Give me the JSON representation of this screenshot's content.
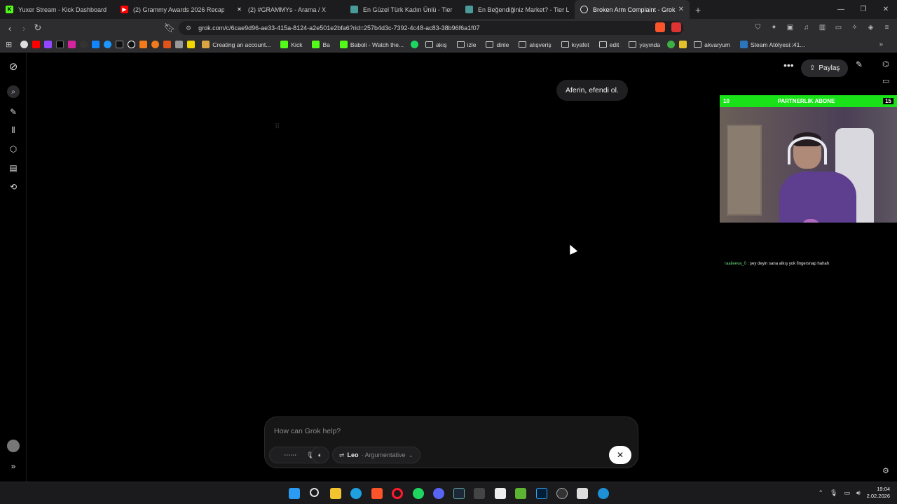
{
  "tabs": [
    {
      "label": "Yuxer Stream - Kick Dashboard",
      "icon": "kick-icon",
      "color": "#53fc18"
    },
    {
      "label": "(2) Grammy Awards 2026 Recap: Win",
      "icon": "youtube-icon",
      "color": "#ff0000"
    },
    {
      "label": "(2) #GRAMMYs - Arama / X",
      "icon": "x-icon",
      "color": "#ffffff"
    },
    {
      "label": "En Güzel Türk Kadın Ünlü - Tier List |",
      "icon": "tiermaker-icon",
      "color": "#4a9a9a"
    },
    {
      "label": "En Beğendiğiniz Market? - Tier List |",
      "icon": "tiermaker-icon",
      "color": "#4a9a9a"
    },
    {
      "label": "Broken Arm Complaint - Grok",
      "icon": "grok-icon",
      "color": "#dddddd",
      "active": true
    }
  ],
  "address": {
    "url": "grok.com/c/6cae9d96-ae33-415a-8124-a2e501e2bfa6?rid=257b4d3c-7392-4c48-ac83-38b96f6a1f07"
  },
  "bookmarks": [
    {
      "label": "Creating an account...",
      "type": "site",
      "color": "#d9a441"
    },
    {
      "label": "Kick",
      "type": "site",
      "color": "#53fc18"
    },
    {
      "label": "Ba",
      "type": "site",
      "color": "#53fc18"
    },
    {
      "label": "Baboli - Watch the...",
      "type": "site",
      "color": "#53fc18"
    },
    {
      "label": "akış",
      "type": "folder"
    },
    {
      "label": "izle",
      "type": "folder"
    },
    {
      "label": "dinle",
      "type": "folder"
    },
    {
      "label": "alışveriş",
      "type": "folder"
    },
    {
      "label": "kıyafet",
      "type": "folder"
    },
    {
      "label": "edit",
      "type": "folder"
    },
    {
      "label": "yayında",
      "type": "folder"
    },
    {
      "label": "akvaryum",
      "type": "folder"
    },
    {
      "label": "Steam Atölyesi::41...",
      "type": "site",
      "color": "#2a75bb"
    }
  ],
  "chat": {
    "user_message": "Aferin, efendi ol.",
    "share_label": "Paylaş",
    "composer_placeholder": "How can Grok help?",
    "model_name": "Leo",
    "model_mode": "· Argumentative"
  },
  "overlay": {
    "left_count": "10",
    "title": "PARTNERLIK ABONE",
    "right_count": "15",
    "chat_user": "raalieeva_0",
    "chat_message": ": şey deyin sana alkış yok fingersnap hahah"
  },
  "taskbar": {
    "time": "19:04",
    "date": "2.02.2026"
  }
}
